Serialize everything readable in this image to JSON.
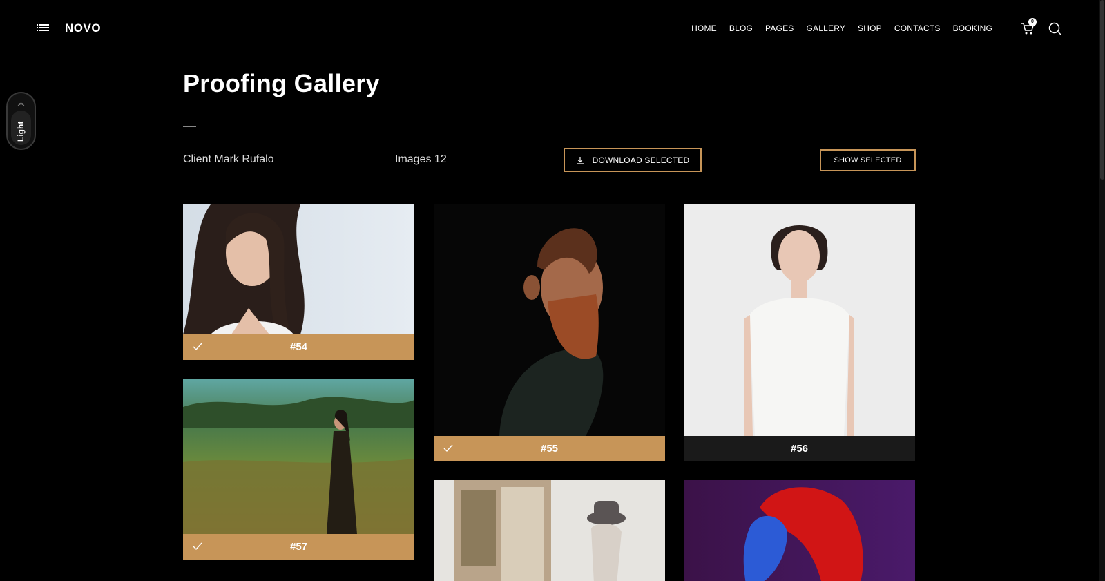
{
  "header": {
    "logo": "NOVO",
    "nav": [
      "HOME",
      "BLOG",
      "PAGES",
      "GALLERY",
      "SHOP",
      "CONTACTS",
      "BOOKING"
    ],
    "active_nav": "GALLERY",
    "cart_count": "0"
  },
  "style_toggle": {
    "label": "Light"
  },
  "page": {
    "title": "Proofing Gallery",
    "client": "Client Mark Rufalo",
    "images": "Images 12",
    "download_label": "DOWNLOAD SELECTED",
    "show_label": "SHOW SELECTED"
  },
  "gallery": [
    {
      "label": "#54",
      "selected": true
    },
    {
      "label": "#55",
      "selected": true
    },
    {
      "label": "#56",
      "selected": false
    },
    {
      "label": "#57",
      "selected": true
    },
    {
      "label": "",
      "selected": false
    },
    {
      "label": "",
      "selected": false
    }
  ],
  "colors": {
    "accent": "#c79558",
    "background": "#000000"
  }
}
